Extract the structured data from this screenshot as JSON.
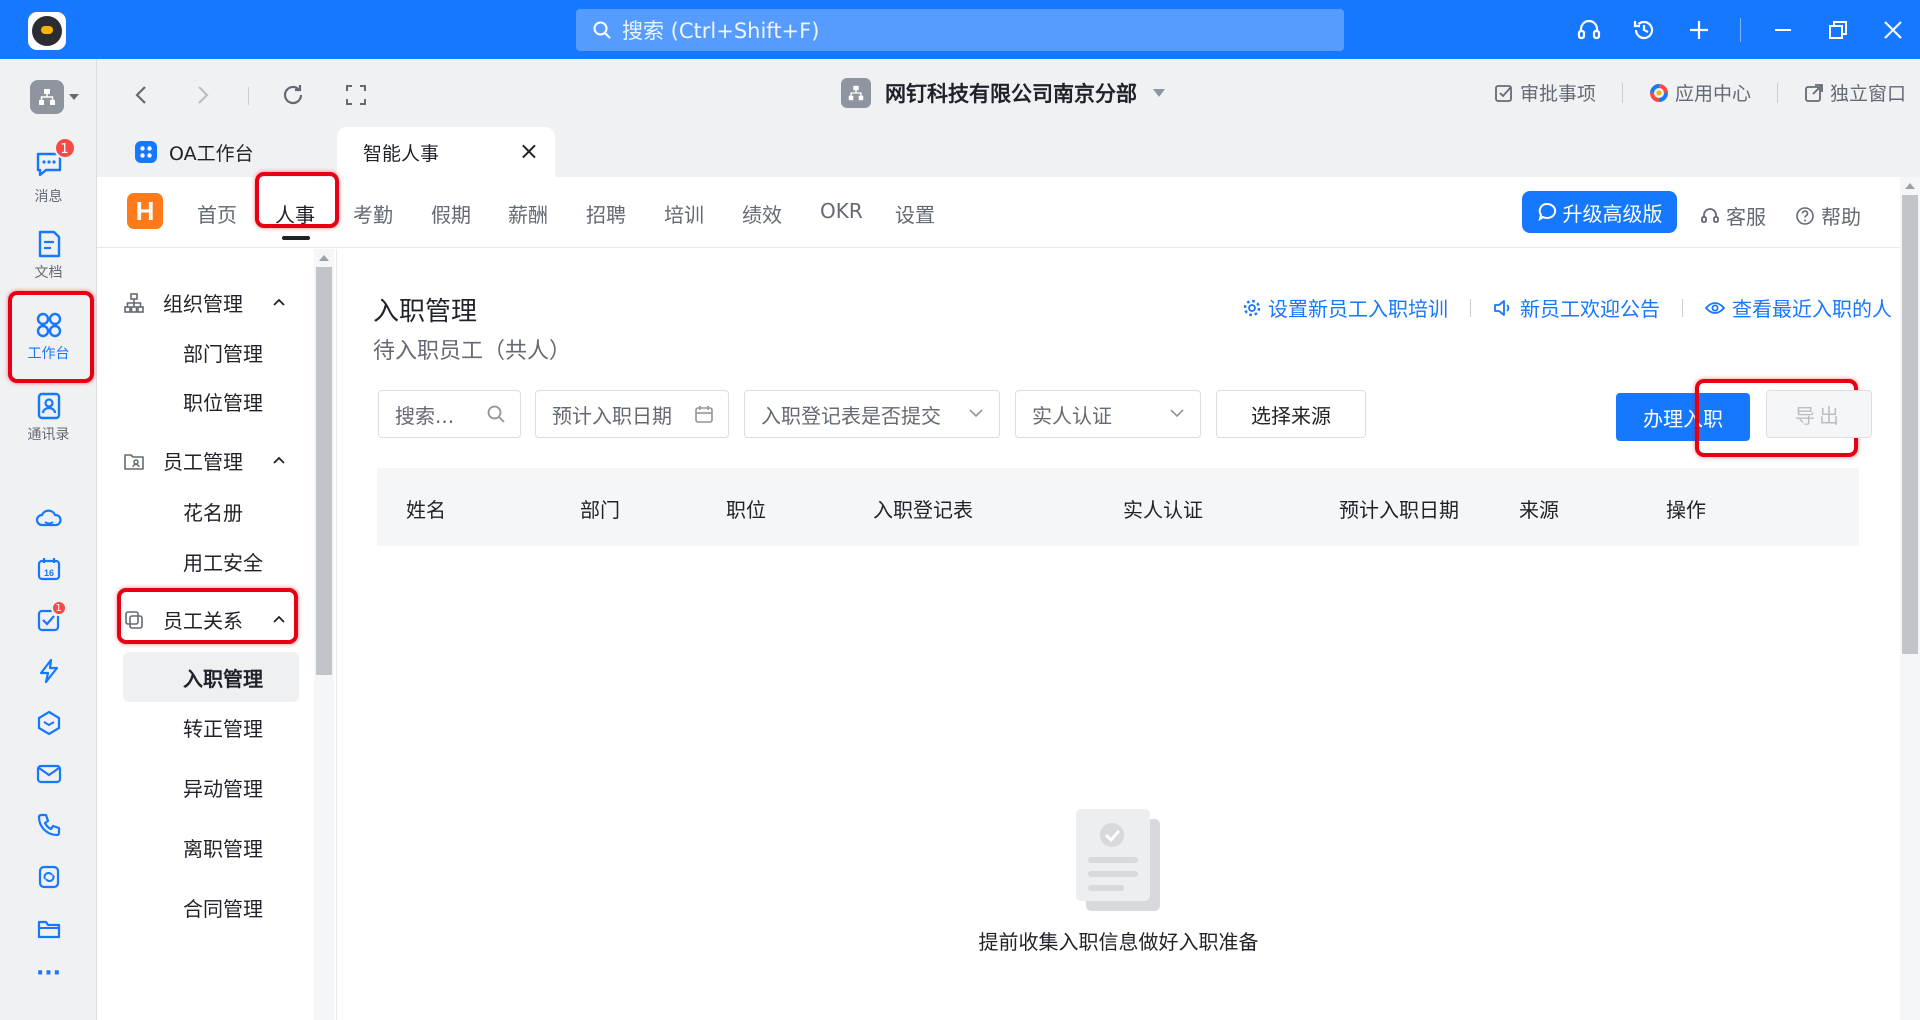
{
  "titlebar": {
    "search_placeholder": "搜索 (Ctrl+Shift+F)",
    "icons": [
      "headset-icon",
      "history-icon",
      "plus-icon",
      "minimize-icon",
      "restore-icon",
      "close-icon"
    ]
  },
  "rail": {
    "items": [
      {
        "label": "消息",
        "badge": "1"
      },
      {
        "label": "文档"
      },
      {
        "label": "工作台"
      },
      {
        "label": "通讯录"
      }
    ],
    "todo_badge": "1",
    "more": "···"
  },
  "navbar": {
    "org_name": "网钉科技有限公司南京分部",
    "approvals": "审批事项",
    "app_center": "应用中心",
    "standalone": "独立窗口"
  },
  "tabs": [
    {
      "label": "OA工作台"
    },
    {
      "label": "智能人事",
      "close": "×"
    }
  ],
  "topnav": {
    "brand": "H",
    "menu": [
      "首页",
      "人事",
      "考勤",
      "假期",
      "薪酬",
      "招聘",
      "培训",
      "绩效",
      "OKR",
      "设置"
    ],
    "active_menu": "人事",
    "upgrade": "升级高级版",
    "service": "客服",
    "help": "帮助"
  },
  "sidemenu": {
    "groups": [
      {
        "label": "组织管理",
        "items": [
          "部门管理",
          "职位管理"
        ]
      },
      {
        "label": "员工管理",
        "items": [
          "花名册",
          "用工安全"
        ]
      },
      {
        "label": "员工关系",
        "items": [
          "入职管理",
          "转正管理",
          "异动管理",
          "离职管理",
          "合同管理"
        ]
      }
    ],
    "active_item": "入职管理"
  },
  "main": {
    "title": "入职管理",
    "subtitle": "待入职员工（共人）",
    "links": [
      "设置新员工入职培训",
      "新员工欢迎公告",
      "查看最近入职的人"
    ],
    "filters": {
      "search_placeholder": "搜索...",
      "expected_date": "预计入职日期",
      "form_submitted": "入职登记表是否提交",
      "real_name": "实人认证",
      "source": "选择来源"
    },
    "primary_button": "办理入职",
    "export_button": "导出",
    "table_headers": [
      "姓名",
      "部门",
      "职位",
      "入职登记表",
      "实人认证",
      "预计入职日期",
      "来源",
      "操作"
    ],
    "empty_text": "提前收集入职信息做好入职准备"
  },
  "colors": {
    "accent": "#1677ff",
    "highlight": "#e60012",
    "badge": "#f54a45",
    "brand": "#ff7a1a"
  }
}
